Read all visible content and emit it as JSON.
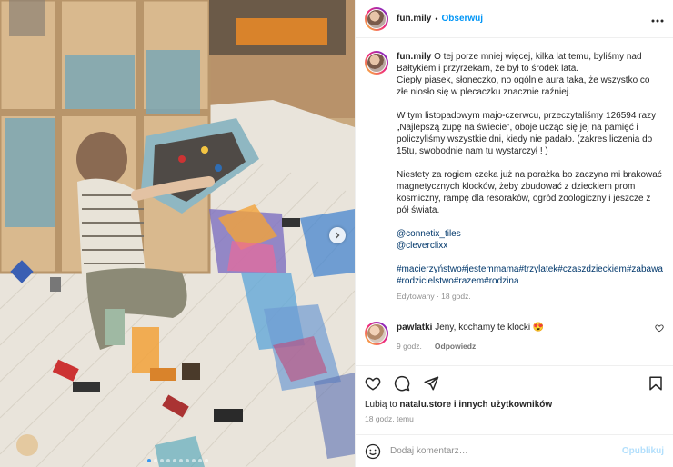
{
  "post": {
    "author": "fun.mily",
    "separator": "•",
    "follow_label": "Obserwuj",
    "more_icon": "more-horizontal-icon"
  },
  "caption": {
    "user": "fun.mily",
    "p1": "O tej porze mniej więcej, kilka lat temu, byliśmy nad Bałtykiem i przyrzekam, że był to środek lata.",
    "p1b": "Ciepły piasek, słoneczko, no ogólnie aura taka, że wszystko co złe niosło się w plecaczku znacznie raźniej.",
    "p2": "W tym listopadowym majo-czerwcu, przeczytaliśmy 126594 razy „Najlepszą zupę na świecie”, oboje ucząc się jej na pamięć i policzyliśmy wszystkie dni, kiedy nie padało. (zakres liczenia do 15tu, swobodnie nam tu wystarczył ! )",
    "p3": "Niestety za rogiem czeka już na porażka bo zaczyna mi brakować magnetycznych klocków, żeby zbudować z dzieckiem prom kosmiczny, rampę dla resoraków, ogród zoologiczny i jeszcze z pół świata.",
    "mention1": "@connetix_tiles",
    "mention2": "@cleverclixx",
    "hashtags": "#macierzyństwo#jestemmama#trzylatek#czaszdzieckiem#zabawa#rodzicielstwo#razem#rodzina",
    "edited": "Edytowany · 18 godz."
  },
  "comment": {
    "user": "pawlatki",
    "text": "Jeny, kochamy te klocki 😍",
    "time": "9 godz.",
    "reply_label": "Odpowiedz"
  },
  "likes": {
    "prefix": "Lubią to",
    "user": "natalu.store",
    "suffix": "i innych użytkowników"
  },
  "timestamp": "18 godz. temu",
  "add_comment": {
    "placeholder": "Dodaj komentarz…",
    "publish_label": "Opublikuj"
  },
  "carousel": {
    "slide_count": 10,
    "active_index": 0
  },
  "colors": {
    "follow": "#0095f6",
    "link": "#00376b",
    "muted": "#8e8e8e",
    "publish_disabled": "#b2dffc"
  }
}
